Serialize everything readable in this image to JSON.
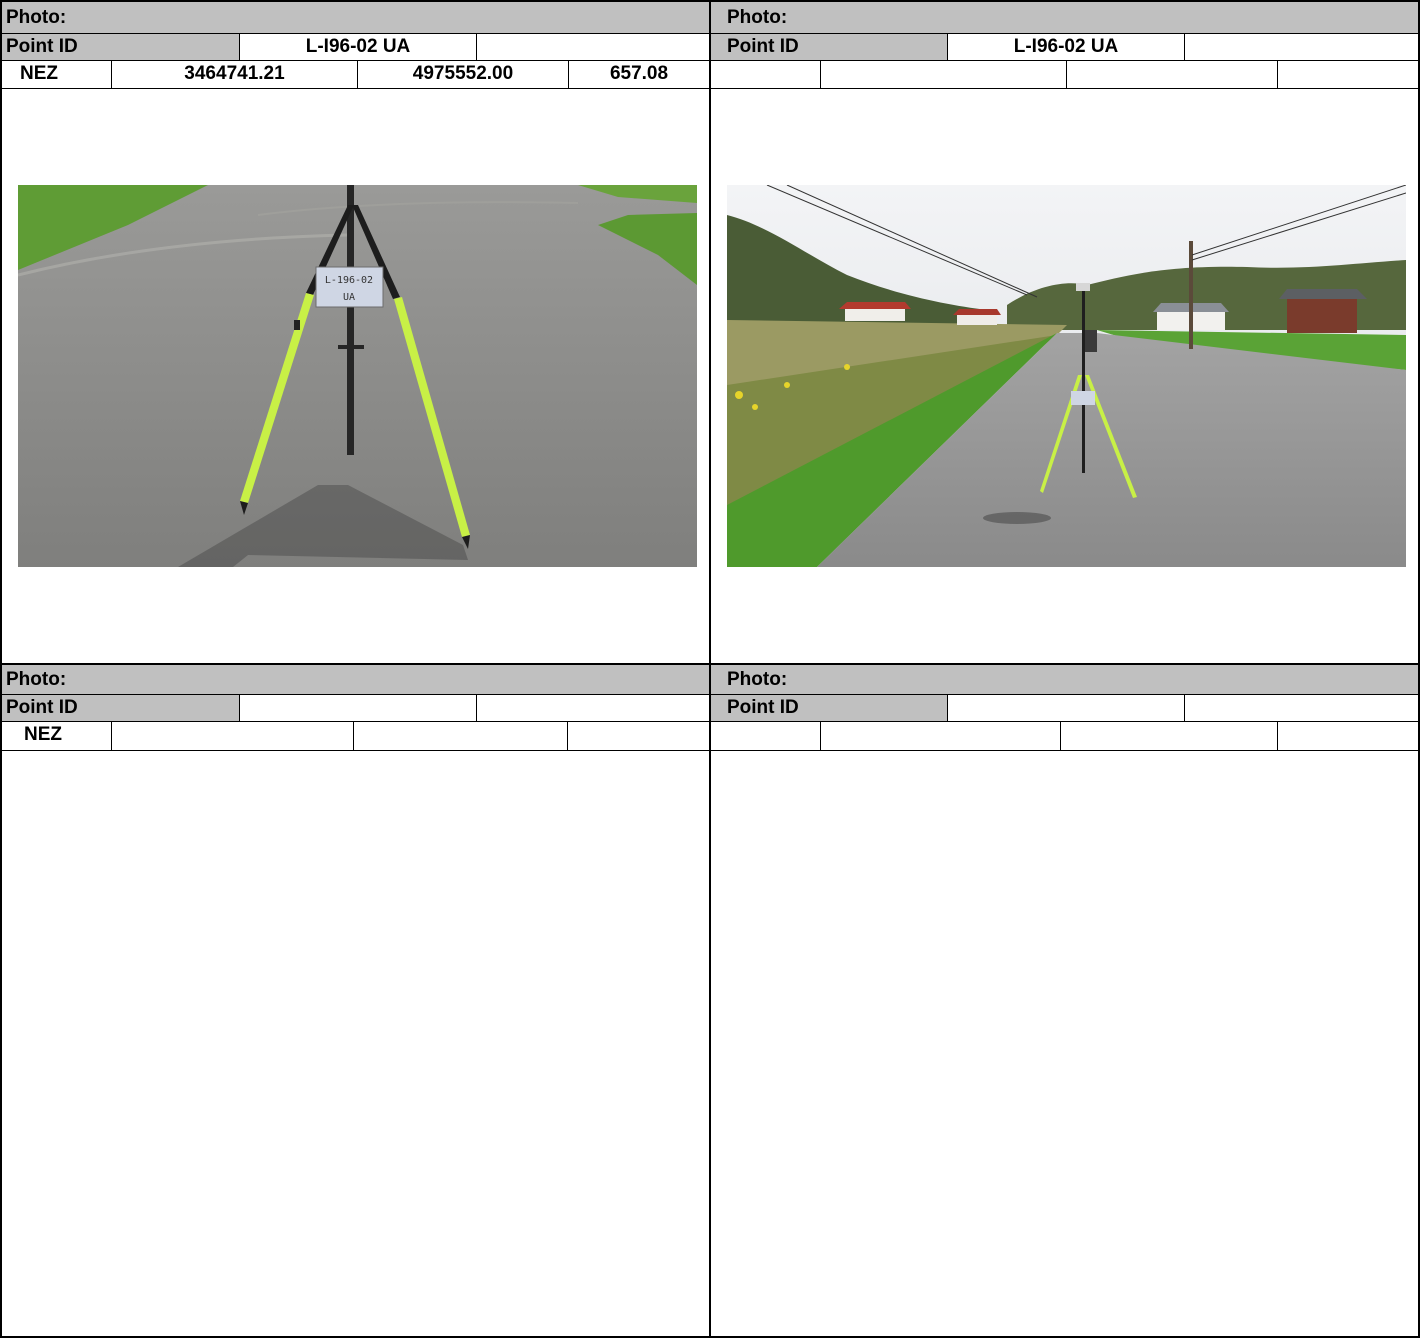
{
  "sheets": [
    {
      "photo_label": "Photo:",
      "point_id_label": "Point ID",
      "point_id_value": "L-I96-02 UA",
      "nez_label": "NEZ",
      "northing": "3464741.21",
      "easting": "4975552.00",
      "elevation": "657.08",
      "sign_line1": "L-196-02",
      "sign_line2": "UA"
    },
    {
      "photo_label": "Photo:",
      "point_id_label": "Point ID",
      "point_id_value": "L-I96-02 UA"
    },
    {
      "photo_label": "Photo:",
      "point_id_label": "Point ID",
      "point_id_value": "",
      "nez_label": "NEZ"
    },
    {
      "photo_label": "Photo:",
      "point_id_label": "Point ID",
      "point_id_value": ""
    }
  ],
  "colors": {
    "header_gray": "#c0c0c0",
    "asphalt": "#8d8d8b",
    "grass": "#5e9a33",
    "tripod_leg": "#c8f046"
  }
}
